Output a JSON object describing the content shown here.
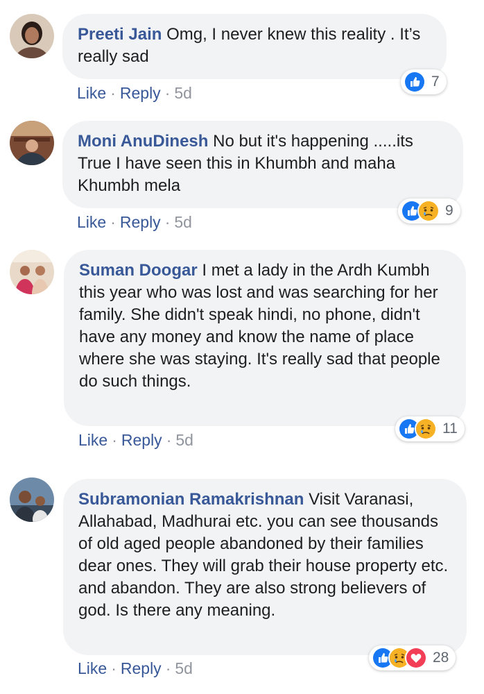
{
  "comments": [
    {
      "author": "Preeti Jain",
      "text": " Omg, I never knew this reality . It’s really sad",
      "like": "Like",
      "reply": "Reply",
      "time": "5d",
      "reaction_count": "7",
      "reactions": [
        "like-icon"
      ]
    },
    {
      "author": "Moni AnuDinesh",
      "text": " No but it's happening .....its True I have seen this in Khumbh and maha Khumbh mela",
      "like": "Like",
      "reply": "Reply",
      "time": "5d",
      "reaction_count": "9",
      "reactions": [
        "like-icon",
        "sad-icon"
      ]
    },
    {
      "author": "Suman Doogar",
      "text": " I met a lady in the Ardh Kumbh this year who was lost and was searching for her family. She didn't speak hindi, no phone, didn't have any money and know the name of place where she was staying. It's really sad that people do such things.",
      "like": "Like",
      "reply": "Reply",
      "time": "5d",
      "reaction_count": "11",
      "reactions": [
        "like-icon",
        "sad-icon"
      ]
    },
    {
      "author": "Subramonian Ramakrishnan",
      "text": " Visit Varanasi, Allahabad, Madhurai etc. you can see thousands of old aged people abandoned by their families dear ones. They will grab their house property etc. and abandon. They are also strong believers of god. Is there any meaning.",
      "like": "Like",
      "reply": "Reply",
      "time": "5d",
      "reaction_count": "28",
      "reactions": [
        "like-icon",
        "sad-icon",
        "love-icon"
      ]
    }
  ],
  "separator": "·",
  "colors": {
    "author": "#385898",
    "bubble": "#f2f3f5",
    "meta": "#90949c",
    "like": "#1877f2",
    "sad": "#f7b125",
    "love": "#f33e58"
  }
}
